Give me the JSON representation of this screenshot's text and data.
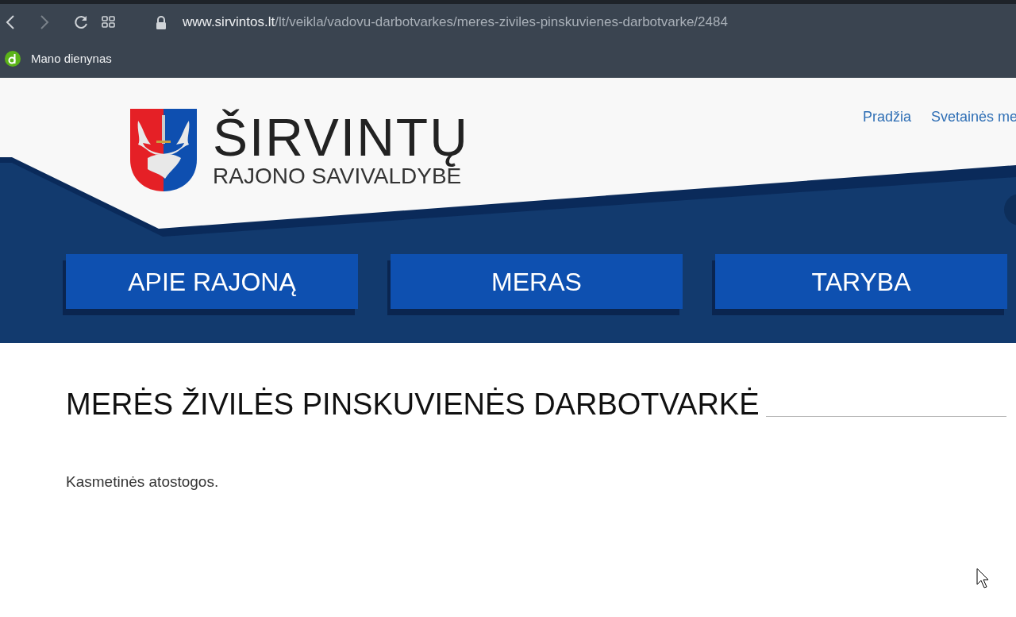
{
  "browser": {
    "url_host": "www.sirvintos.lt",
    "url_path": "/lt/veikla/vadovu-darbotvarkes/meres-ziviles-pinskuvienes-darbotvarke/2484",
    "bookmarks": [
      {
        "label": "Mano dienynas"
      }
    ]
  },
  "site": {
    "logo_title": "ŠIRVINTŲ",
    "logo_subtitle": "RAJONO SAVIVALDYBĖ",
    "top_links": [
      "Pradžia",
      "Svetainės me"
    ],
    "nav": [
      "APIE RAJONĄ",
      "MERAS",
      "TARYBA"
    ]
  },
  "page": {
    "title": "MERĖS ŽIVILĖS PINSKUVIENĖS DARBOTVARKĖ",
    "text": "Kasmetinės atostogos."
  }
}
